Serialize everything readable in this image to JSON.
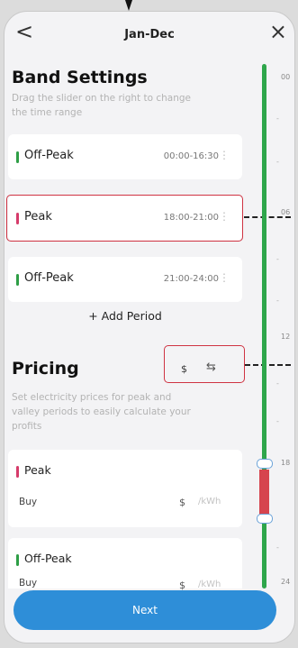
{
  "header": {
    "title": "Jan-Dec",
    "back_glyph": "<",
    "close_glyph": "×"
  },
  "band": {
    "title": "Band Settings",
    "subtitle_lines": [
      "Drag the slider on the right to change",
      "the time range"
    ],
    "rows": [
      {
        "label": "Off-Peak",
        "time": "00:00-16:30"
      },
      {
        "label": "Peak",
        "time": "18:00-21:00"
      },
      {
        "label": "Off-Peak",
        "time": "21:00-24:00"
      }
    ],
    "add_label": "+  Add Period"
  },
  "pricing": {
    "title": "Pricing",
    "currency": "$",
    "swap_glyph": "⇆",
    "subtitle_lines": [
      "Set electricity prices for peak and",
      "valley periods to easily calculate your",
      "profits"
    ],
    "items": [
      {
        "label": "Peak",
        "buy_label": "Buy",
        "currency": "$",
        "unit": "/kWh"
      },
      {
        "label": "Off-Peak",
        "buy_label": "Buy",
        "currency": "$",
        "unit": "/kWh"
      }
    ]
  },
  "slider": {
    "hours": [
      "00",
      "06",
      "12",
      "18",
      "24"
    ],
    "peak_range_hours": [
      18,
      21
    ]
  },
  "footer": {
    "next_label": "Next"
  },
  "colors": {
    "accent": "#2e8ed8",
    "offpeak": "#2e9e46",
    "peak": "#d63b6a",
    "highlight": "#cf3342"
  }
}
